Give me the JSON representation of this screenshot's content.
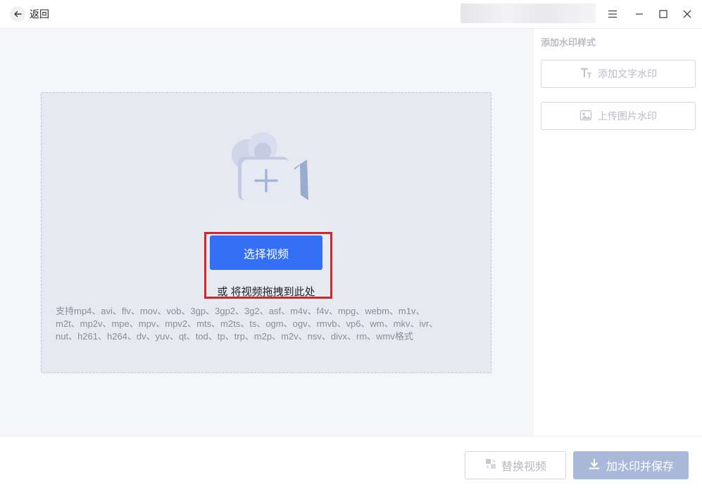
{
  "titlebar": {
    "back_label": "返回",
    "icons": [
      "back-arrow-icon",
      "menu-icon",
      "minimize-icon",
      "maximize-icon",
      "close-icon"
    ]
  },
  "upload": {
    "select_button": "选择视频",
    "drag_hint": "或 将视频拖拽到此处",
    "formats": [
      "支持mp4、avi、flv、mov、vob、3gp、3gp2、3g2、asf、m4v、f4v、mpg、webm、m1v、",
      "m2t、mp2v、mpe、mpv、mpv2、mts、m2ts、ts、ogm、ogv、rmvb、vp6、wm、mkv、ivr、",
      "nut、h261、h264、dv、yuv、qt、tod、tp、trp、m2p、m2v、nsv、divx、rm、wmv格式"
    ]
  },
  "side_panel": {
    "title": "添加水印样式",
    "add_text_label": "添加文字水印",
    "upload_image_label": "上传图片水印"
  },
  "footer": {
    "replace_label": "替换视频",
    "save_label": "加水印并保存"
  },
  "colors": {
    "primary": "#3370f6",
    "highlight_border": "#d0262c",
    "disabled_primary": "#aab9da",
    "dropzone_bg": "#e7e9f0"
  }
}
